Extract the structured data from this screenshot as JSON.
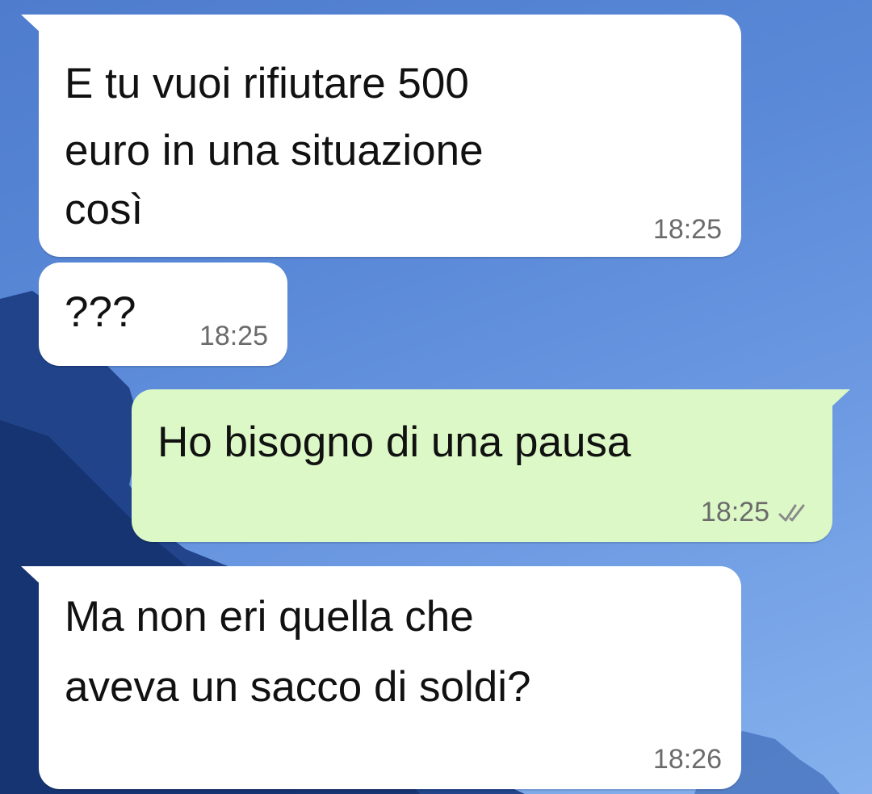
{
  "colors": {
    "incoming_bubble": "#ffffff",
    "outgoing_bubble": "#dcf8c6",
    "timestamp": "#6b6b6b",
    "wallpaper": "#5a89d8"
  },
  "messages": [
    {
      "direction": "incoming",
      "lines": [
        "E tu vuoi rifiutare 500",
        "euro in una situazione",
        "così"
      ],
      "time": "18:25"
    },
    {
      "direction": "incoming",
      "lines": [
        "???"
      ],
      "time": "18:25"
    },
    {
      "direction": "outgoing",
      "lines": [
        "Ho bisogno di una pausa"
      ],
      "time": "18:25",
      "status_icon": "double-check-icon"
    },
    {
      "direction": "incoming",
      "lines": [
        "Ma non eri quella che",
        "aveva un sacco di soldi?"
      ],
      "time": "18:26"
    }
  ]
}
